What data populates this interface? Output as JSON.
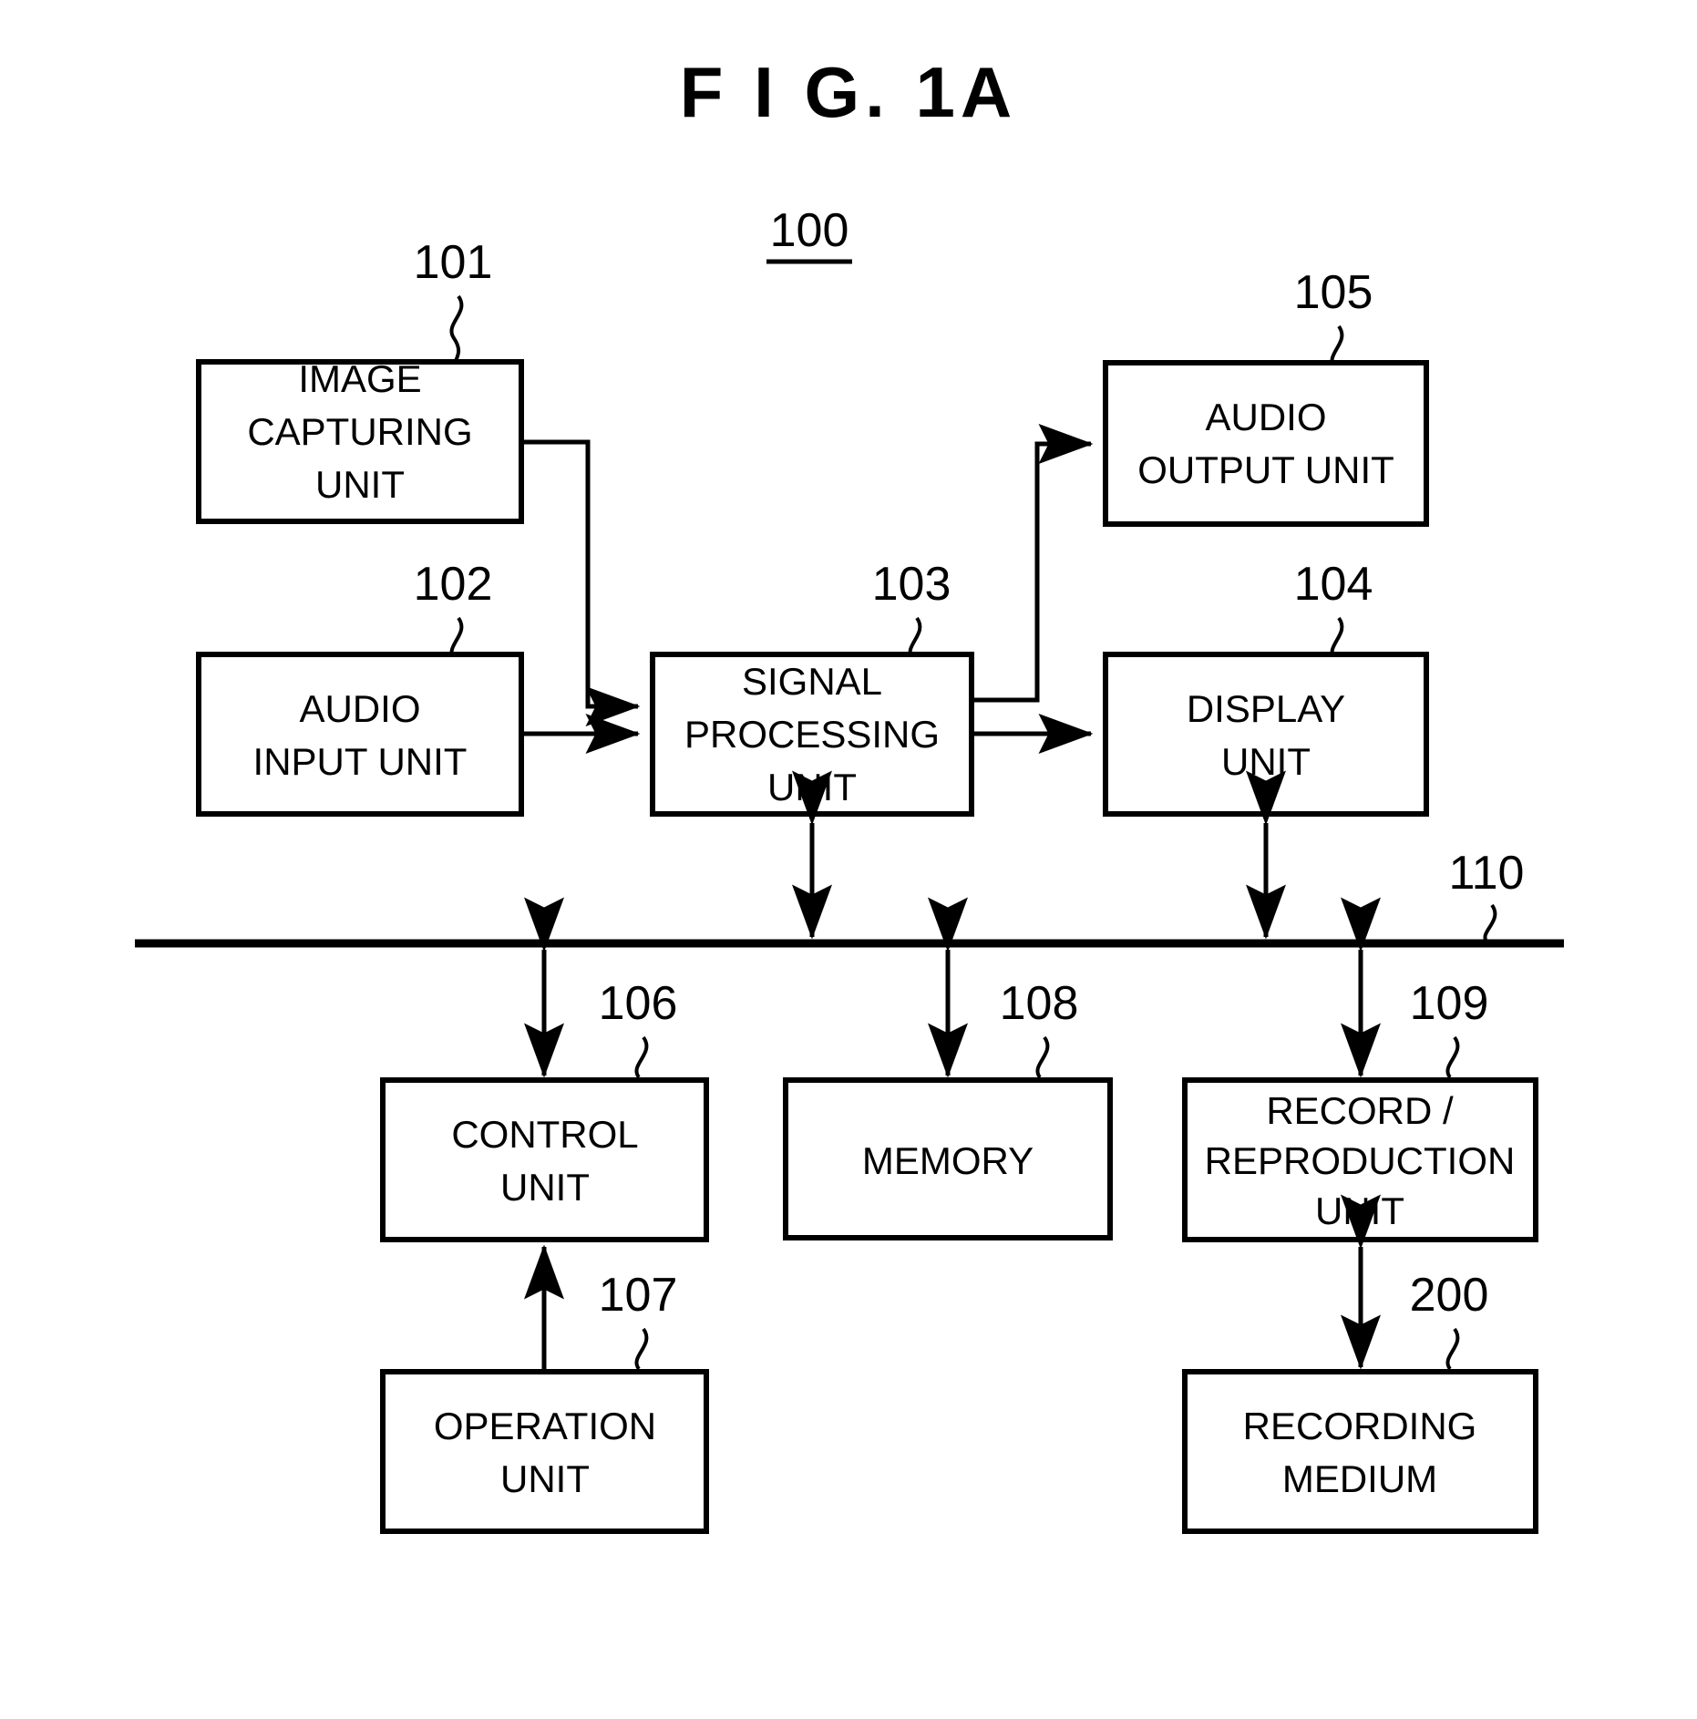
{
  "figure": {
    "title": "F I G.  1A",
    "system_ref": "100"
  },
  "blocks": [
    {
      "id": "image-capturing-unit",
      "ref": "101",
      "lines": [
        "IMAGE",
        "CAPTURING",
        "UNIT"
      ]
    },
    {
      "id": "audio-input-unit",
      "ref": "102",
      "lines": [
        "AUDIO",
        "INPUT UNIT"
      ]
    },
    {
      "id": "signal-processing-unit",
      "ref": "103",
      "lines": [
        "SIGNAL",
        "PROCESSING",
        "UNIT"
      ]
    },
    {
      "id": "display-unit",
      "ref": "104",
      "lines": [
        "DISPLAY",
        "UNIT"
      ]
    },
    {
      "id": "audio-output-unit",
      "ref": "105",
      "lines": [
        "AUDIO",
        "OUTPUT UNIT"
      ]
    },
    {
      "id": "control-unit",
      "ref": "106",
      "lines": [
        "CONTROL",
        "UNIT"
      ]
    },
    {
      "id": "operation-unit",
      "ref": "107",
      "lines": [
        "OPERATION",
        "UNIT"
      ]
    },
    {
      "id": "memory",
      "ref": "108",
      "lines": [
        "MEMORY"
      ]
    },
    {
      "id": "record-reproduction-unit",
      "ref": "109",
      "lines": [
        "RECORD /",
        "REPRODUCTION",
        "UNIT"
      ]
    },
    {
      "id": "recording-medium",
      "ref": "200",
      "lines": [
        "RECORDING",
        "MEDIUM"
      ]
    }
  ],
  "bus": {
    "ref": "110"
  },
  "text": {
    "title": "F I G.  1A",
    "ref_100": "100",
    "ref_101": "101",
    "ref_102": "102",
    "ref_103": "103",
    "ref_104": "104",
    "ref_105": "105",
    "ref_106": "106",
    "ref_107": "107",
    "ref_108": "108",
    "ref_109": "109",
    "ref_110": "110",
    "ref_200": "200",
    "image_capturing_l1": "IMAGE",
    "image_capturing_l2": "CAPTURING",
    "image_capturing_l3": "UNIT",
    "audio_input_l1": "AUDIO",
    "audio_input_l2": "INPUT UNIT",
    "signal_processing_l1": "SIGNAL",
    "signal_processing_l2": "PROCESSING",
    "signal_processing_l3": "UNIT",
    "display_l1": "DISPLAY",
    "display_l2": "UNIT",
    "audio_output_l1": "AUDIO",
    "audio_output_l2": "OUTPUT UNIT",
    "control_l1": "CONTROL",
    "control_l2": "UNIT",
    "operation_l1": "OPERATION",
    "operation_l2": "UNIT",
    "memory_l1": "MEMORY",
    "record_l1": "RECORD /",
    "record_l2": "REPRODUCTION",
    "record_l3": "UNIT",
    "recording_medium_l1": "RECORDING",
    "recording_medium_l2": "MEDIUM"
  },
  "colors": {
    "ink": "#000000",
    "paper": "#ffffff"
  }
}
